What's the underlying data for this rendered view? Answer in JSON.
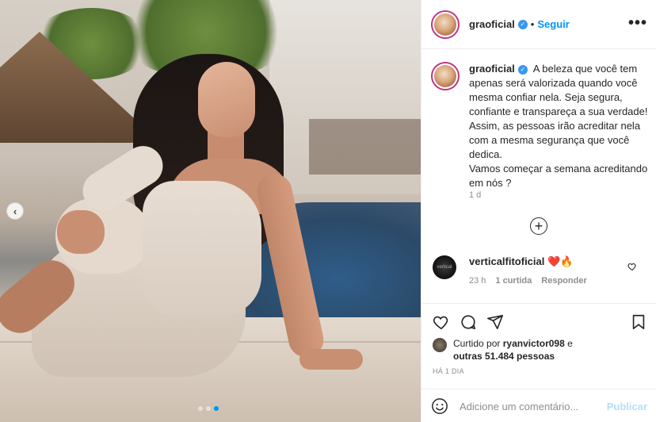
{
  "header": {
    "username": "graoficial",
    "separator": "•",
    "follow_label": "Seguir",
    "more_label": "•••",
    "verified_mark": "✓"
  },
  "caption": {
    "username": "graoficial",
    "text": "A beleza que você tem apenas será valorizada quando você mesma confiar nela. Seja segura, confiante e transpareça a sua verdade! Assim, as pessoas irão acreditar nela com a mesma segurança que você dedica.\nVamos começar a semana acreditando em nós ?",
    "time": "1 d"
  },
  "load_more": {
    "icon": "plus-circle-icon",
    "symbol": "+"
  },
  "comments": [
    {
      "username": "verticalfitoficial",
      "text": "❤️🔥",
      "time": "23 h",
      "likes": "1 curtida",
      "reply_label": "Responder",
      "avatar_text": "vertical"
    }
  ],
  "actions": {
    "like_icon": "heart-icon",
    "comment_icon": "comment-icon",
    "share_icon": "send-icon",
    "save_icon": "bookmark-icon"
  },
  "likes": {
    "prefix": "Curtido por",
    "user": "ryanvictor098",
    "connector": "e",
    "others": "outras 51.484 pessoas"
  },
  "post_time": "HÁ 1 DIA",
  "add_comment": {
    "placeholder": "Adicione um comentário...",
    "publish_label": "Publicar",
    "emoji_icon": "emoji-icon"
  },
  "carousel": {
    "prev_symbol": "‹",
    "total_slides": 3,
    "active_slide": 3
  },
  "colors": {
    "accent": "#0095f6",
    "verified": "#3897f0",
    "publish_disabled": "#b2dffc",
    "heart": "#ed4956"
  }
}
